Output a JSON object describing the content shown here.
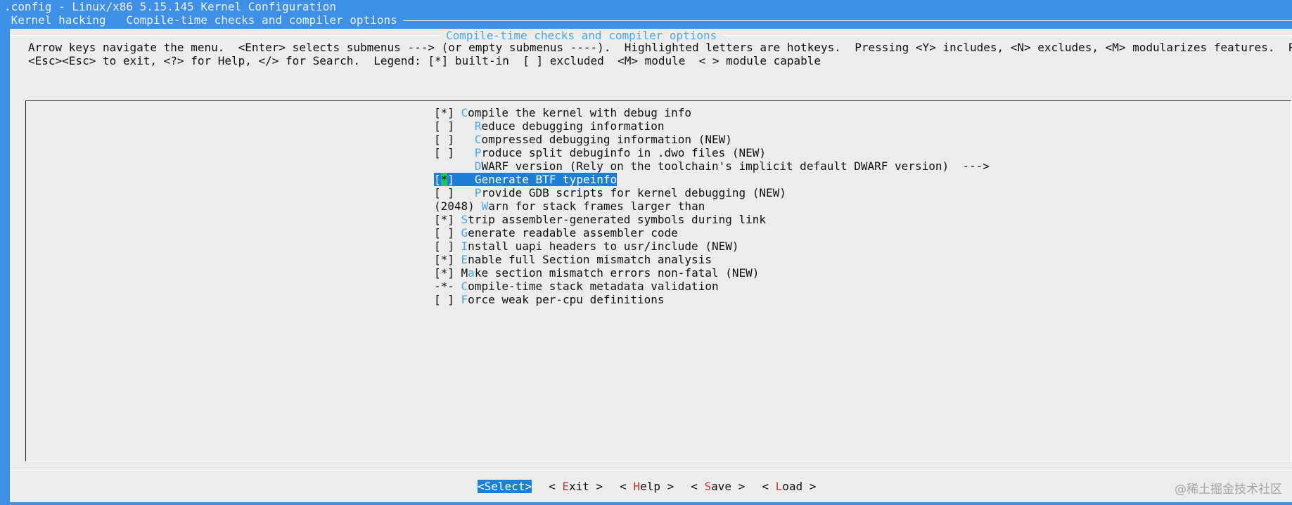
{
  "window": {
    "title": ".config - Linux/x86 5.15.145 Kernel Configuration",
    "breadcrumb": [
      " Kernel hacking",
      " Compile-time checks and compiler options"
    ]
  },
  "dialog": {
    "title": "Compile-time checks and compiler options",
    "help_line_1": "Arrow keys navigate the menu.  <Enter> selects submenus ---> (or empty submenus ----).  Highlighted letters are hotkeys.  Pressing <Y> includes, <N> excludes, <M> modularizes features.  Press",
    "help_line_2": "<Esc><Esc> to exit, <?> for Help, </> for Search.  Legend: [*] built-in  [ ] excluded  <M> module  < > module capable"
  },
  "menu": {
    "items": [
      {
        "prefix": "[*] ",
        "hotkey": "C",
        "rest": "ompile the kernel with debug info"
      },
      {
        "prefix": "[ ]   ",
        "hotkey": "R",
        "rest": "educe debugging information"
      },
      {
        "prefix": "[ ]   ",
        "hotkey": "C",
        "rest": "ompressed debugging information (NEW)"
      },
      {
        "prefix": "[ ]   ",
        "hotkey": "P",
        "rest": "roduce split debuginfo in .dwo files (NEW)"
      },
      {
        "prefix": "      ",
        "hotkey": "D",
        "rest": "WARF version (Rely on the toolchain's implicit default DWARF version)  --->"
      },
      {
        "prefix_a": "[",
        "cursor": "*",
        "prefix_b": "]   ",
        "hotkey": "G",
        "rest": "enerate BTF typeinfo"
      },
      {
        "prefix": "[ ]   ",
        "hotkey": "P",
        "rest": "rovide GDB scripts for kernel debugging (NEW)"
      },
      {
        "prefix": "(2048) ",
        "hotkey": "W",
        "rest": "arn for stack frames larger than"
      },
      {
        "prefix": "[*] ",
        "hotkey": "S",
        "rest": "trip assembler-generated symbols during link"
      },
      {
        "prefix": "[ ] ",
        "hotkey": "G",
        "rest": "enerate readable assembler code"
      },
      {
        "prefix": "[ ] ",
        "hotkey": "I",
        "rest": "nstall uapi headers to usr/include (NEW)"
      },
      {
        "prefix": "[*] ",
        "hotkey": "E",
        "rest": "nable full Section mismatch analysis"
      },
      {
        "prefix": "[*] M",
        "hotkey": "a",
        "rest": "ke section mismatch errors non-fatal (NEW)"
      },
      {
        "prefix": "-*- ",
        "hotkey": "C",
        "rest": "ompile-time stack metadata validation"
      },
      {
        "prefix": "[ ] ",
        "hotkey": "F",
        "rest": "orce weak per-cpu definitions"
      }
    ]
  },
  "buttons": [
    {
      "pre": "<",
      "hotkey": "S",
      "post": "elect>"
    },
    {
      "pre": "< ",
      "hotkey": "E",
      "post": "xit >"
    },
    {
      "pre": "< ",
      "hotkey": "H",
      "post": "elp >"
    },
    {
      "pre": "< ",
      "hotkey": "S",
      "post": "ave >"
    },
    {
      "pre": "< ",
      "hotkey": "L",
      "post": "oad >"
    }
  ],
  "watermark": "@稀土掘金技术社区"
}
